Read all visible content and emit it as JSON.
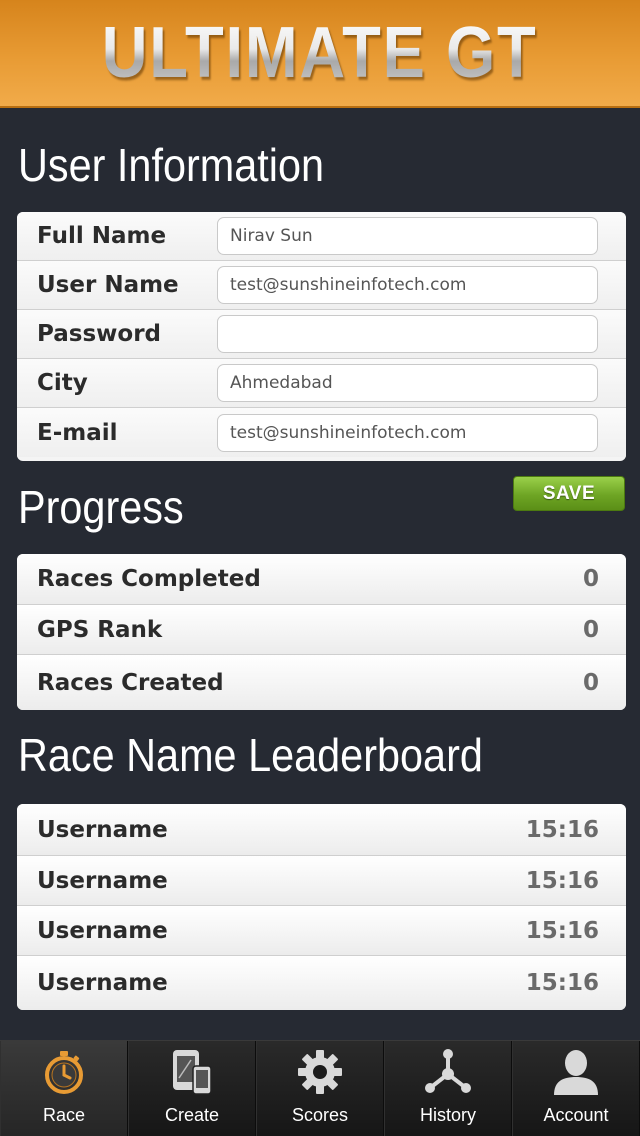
{
  "header": {
    "title": "ULTIMATE GT"
  },
  "user_info": {
    "title": "User Information",
    "fields": [
      {
        "label": "Full Name",
        "value": "Nirav Sun"
      },
      {
        "label": "User Name",
        "value": "test@sunshineinfotech.com"
      },
      {
        "label": "Password",
        "value": ""
      },
      {
        "label": "City",
        "value": "Ahmedabad"
      },
      {
        "label": "E-mail",
        "value": "test@sunshineinfotech.com"
      }
    ]
  },
  "save_label": "SAVE",
  "progress": {
    "title": "Progress",
    "rows": [
      {
        "label": "Races Completed",
        "value": "0"
      },
      {
        "label": "GPS Rank",
        "value": "0"
      },
      {
        "label": "Races Created",
        "value": "0"
      }
    ]
  },
  "leaderboard": {
    "title": "Race Name Leaderboard",
    "rows": [
      {
        "name": "Username",
        "time": "15:16"
      },
      {
        "name": "Username",
        "time": "15:16"
      },
      {
        "name": "Username",
        "time": "15:16"
      },
      {
        "name": "Username",
        "time": "15:16"
      }
    ]
  },
  "tabs": [
    {
      "label": "Race",
      "icon": "stopwatch-icon",
      "active": true
    },
    {
      "label": "Create",
      "icon": "devices-icon",
      "active": false
    },
    {
      "label": "Scores",
      "icon": "gear-icon",
      "active": false
    },
    {
      "label": "History",
      "icon": "network-icon",
      "active": false
    },
    {
      "label": "Account",
      "icon": "person-icon",
      "active": false
    }
  ],
  "colors": {
    "header_orange": "#e89b34",
    "background": "#262a33",
    "save_green": "#6ea524",
    "active_icon_orange": "#e89b34"
  }
}
